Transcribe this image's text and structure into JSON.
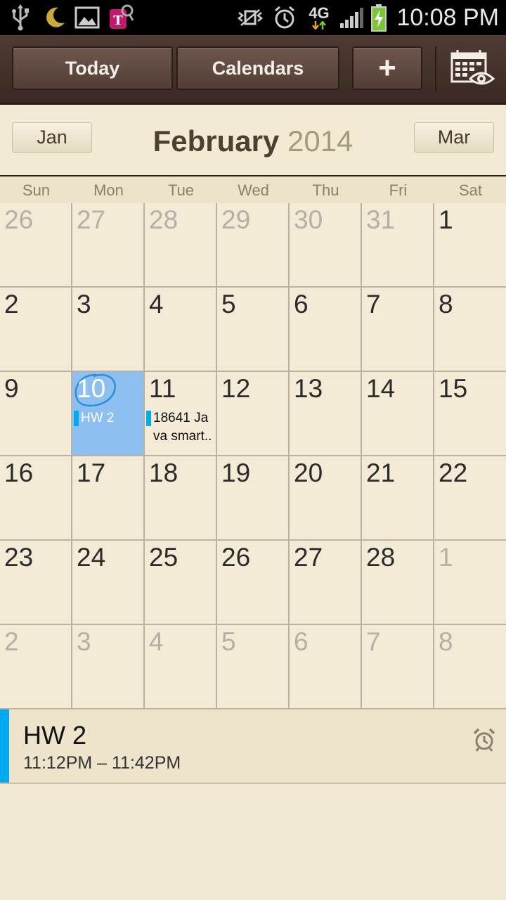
{
  "status_bar": {
    "time": "10:08 PM",
    "network": "4G",
    "icons": [
      "usb-icon",
      "moon-icon",
      "image-icon",
      "tmobile-icon",
      "vibrate-icon",
      "alarm-icon",
      "network-4g-icon",
      "signal-icon",
      "battery-charging-icon"
    ]
  },
  "toolbar": {
    "today_label": "Today",
    "calendars_label": "Calendars",
    "add_label": "+",
    "view_icon": "calendar-view-icon"
  },
  "month_header": {
    "prev_label": "Jan",
    "next_label": "Mar",
    "month": "February",
    "year": "2014"
  },
  "weekdays": [
    "Sun",
    "Mon",
    "Tue",
    "Wed",
    "Thu",
    "Fri",
    "Sat"
  ],
  "weeks": [
    [
      {
        "d": "26",
        "other": true
      },
      {
        "d": "27",
        "other": true
      },
      {
        "d": "28",
        "other": true
      },
      {
        "d": "29",
        "other": true
      },
      {
        "d": "30",
        "other": true
      },
      {
        "d": "31",
        "other": true
      },
      {
        "d": "1"
      }
    ],
    [
      {
        "d": "2"
      },
      {
        "d": "3"
      },
      {
        "d": "4"
      },
      {
        "d": "5"
      },
      {
        "d": "6"
      },
      {
        "d": "7"
      },
      {
        "d": "8"
      }
    ],
    [
      {
        "d": "9"
      },
      {
        "d": "10",
        "selected": true,
        "event": "HW 2"
      },
      {
        "d": "11",
        "event": "18641 Ja va smart.."
      },
      {
        "d": "12"
      },
      {
        "d": "13"
      },
      {
        "d": "14"
      },
      {
        "d": "15"
      }
    ],
    [
      {
        "d": "16"
      },
      {
        "d": "17"
      },
      {
        "d": "18"
      },
      {
        "d": "19"
      },
      {
        "d": "20"
      },
      {
        "d": "21"
      },
      {
        "d": "22"
      }
    ],
    [
      {
        "d": "23"
      },
      {
        "d": "24"
      },
      {
        "d": "25"
      },
      {
        "d": "26"
      },
      {
        "d": "27"
      },
      {
        "d": "28"
      },
      {
        "d": "1",
        "other": true
      }
    ],
    [
      {
        "d": "2",
        "other": true
      },
      {
        "d": "3",
        "other": true
      },
      {
        "d": "4",
        "other": true
      },
      {
        "d": "5",
        "other": true
      },
      {
        "d": "6",
        "other": true
      },
      {
        "d": "7",
        "other": true
      },
      {
        "d": "8",
        "other": true
      }
    ]
  ],
  "event_detail": {
    "title": "HW 2",
    "time": "11:12PM – 11:42PM",
    "alarm_icon": "alarm-icon"
  },
  "colors": {
    "event_accent": "#00aaf0",
    "selected_day": "#8dbff0",
    "today_circle": "#2a8fd8"
  }
}
